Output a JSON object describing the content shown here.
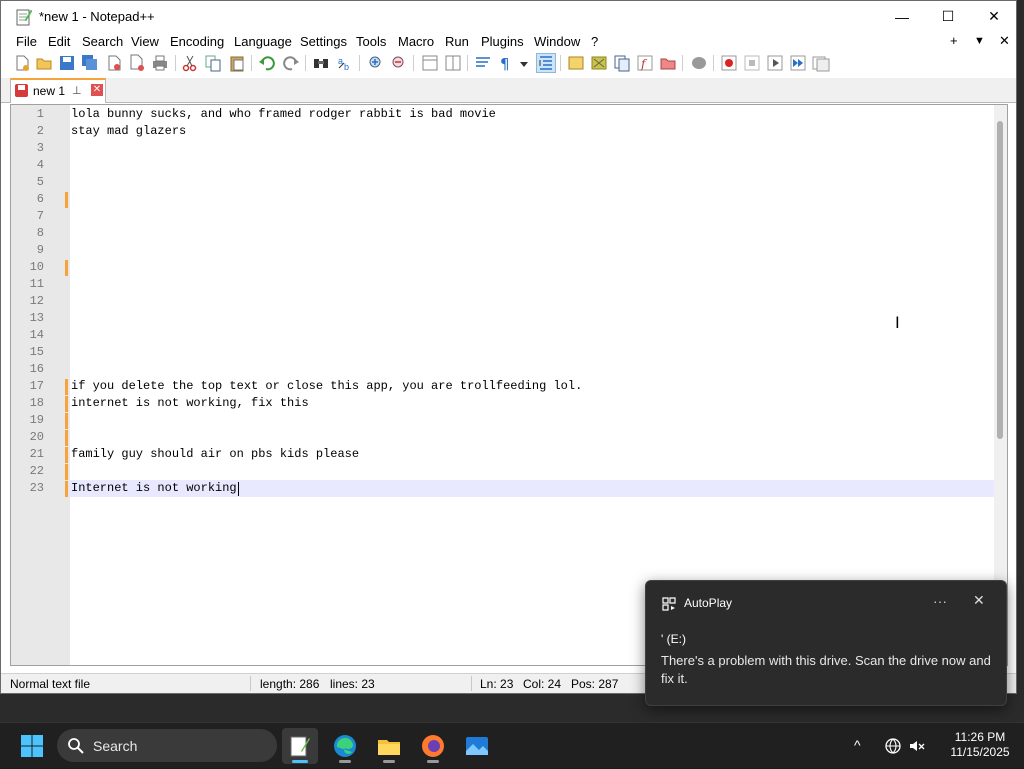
{
  "window": {
    "title": "*new 1 - Notepad++",
    "minimize": "—",
    "maximize": "☐",
    "close": "✕"
  },
  "menu": {
    "items": [
      "File",
      "Edit",
      "Search",
      "View",
      "Encoding",
      "Language",
      "Settings",
      "Tools",
      "Macro",
      "Run",
      "Plugins",
      "Window",
      "?"
    ],
    "right_plus": "+",
    "right_dropdown": "▼",
    "right_close": "✕"
  },
  "tab": {
    "label": "new 1",
    "pin": "📌",
    "close": "✕"
  },
  "editor": {
    "line_numbers": [
      "1",
      "2",
      "3",
      "4",
      "5",
      "6",
      "7",
      "8",
      "9",
      "10",
      "11",
      "12",
      "13",
      "14",
      "15",
      "16",
      "17",
      "18",
      "19",
      "20",
      "21",
      "22",
      "23"
    ],
    "lines": [
      "lola bunny sucks, and who framed rodger rabbit is bad movie",
      "stay mad glazers",
      "",
      "",
      "",
      "",
      "",
      "",
      "",
      "",
      "",
      "",
      "",
      "",
      "",
      "",
      "if you delete the top text or close this app, you are trollfeeding lol.",
      "internet is not working, fix this",
      "",
      "",
      "family guy should air on pbs kids please",
      "",
      "Internet is not working"
    ],
    "changed_lines": [
      6,
      10,
      17,
      18,
      19,
      20,
      21,
      22,
      23
    ],
    "current_line": 23
  },
  "status": {
    "file_type": "Normal text file",
    "length": "length: 286",
    "lines": "lines: 23",
    "ln": "Ln: 23",
    "col": "Col: 24",
    "pos": "Pos: 287"
  },
  "toast": {
    "app": "AutoPlay",
    "more": "···",
    "close": "✕",
    "title": "' (E:)",
    "body": "There's a problem with this drive.  Scan the drive now and fix it."
  },
  "taskbar": {
    "search_label": "Search",
    "tray_chevron": "^",
    "time": "11:26 PM",
    "date": "11/15/2025"
  },
  "colors": {
    "change_marker": "#f7a33b",
    "current_line": "#e8e8ff",
    "accent": "#4cc2ff"
  }
}
